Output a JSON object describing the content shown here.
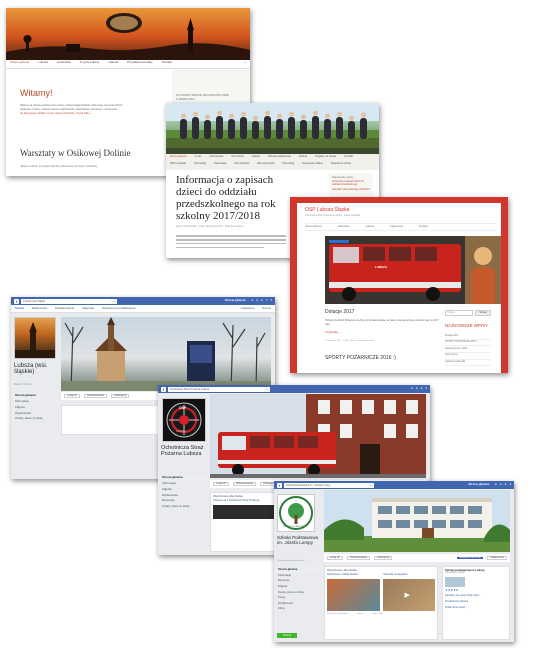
{
  "site1": {
    "nav": [
      "Strona główna",
      "Lubsza",
      "Jednostka",
      "Z życia Lubszy",
      "Galeria",
      "Przydatne kontakty",
      "Kontakt"
    ],
    "heading": "Witamy!",
    "section_title": "Warsztaty w Osikowej Dolinie",
    "sidebar_title": "STOWARZYSZENIE MIŁOŚNIKÓW ZIEMI LUBSZECKIEJ",
    "body_lines": [
      "Witamy na stronie poświęconej Lubszy. Tutaj znajdą Państwo informacje na temat historii",
      "wydarzeń, kultury i tradycji naszej miejscowości. Zapraszamy do lektury i zachęcamy",
      "do aktywnego udziału w życiu naszej wspólnoty. Czytaj dalej →"
    ],
    "caption": "„Bitwa o kulturę” to projekt kulturalny skierowany do dzieci i młodzieży"
  },
  "site2": {
    "nav_row1": [
      "Strona główna",
      "O nas",
      "Nauczyciele",
      "Dla ucznia",
      "Galeria",
      "Szkoła podstawowa",
      "Kultura",
      "Projekty na szkołę",
      "Kontakt"
    ],
    "nav_row2": [
      "RPO Lubelski",
      "Informacje",
      "Rekrutacja",
      "Dla rodziców",
      "Dla nauczycieli",
      "Plan lekcji",
      "Nauczanie zdalne",
      "Regulamin szkoły"
    ],
    "title_lines": [
      "Informacja o zapisach",
      "dzieci do oddziału",
      "przedszkolnego na rok",
      "szkolny 2017/2018"
    ],
    "meta": "Autor: administrator · Data: 12 kwietnia 2017 · Brak komentarzy",
    "sidebar_title": "Najnowsze wpisy",
    "sidebar_lines": [
      "Informacja o zapisach dzieci do oddziału przedszkolnego",
      "Kalendarz roku szkolnego 2016/2017"
    ]
  },
  "site3": {
    "title": "OSP Lubsza Śląska",
    "subtitle": "Ochotnicza Straż Pożarna w Lubszy · strona jednostki",
    "tabs": [
      "Strona główna",
      "Jednostka",
      "Galeria",
      "Ogłoszenia",
      "Kontakt"
    ],
    "post_title": "Dotacje 2017",
    "post_text": "Ochotnicza Straż Pożarna w Lubszy otrzymała dotację na zakup nowego sprzętu ratowniczego w 2017 roku.",
    "read_more": "Czytaj dalej →",
    "post_meta": "25 kwietnia 2017 · OSP Lubsza · Brak komentarzy",
    "section2_title": "SPORTY POŻARNICZE 2016 :)",
    "search_placeholder": "Szukaj...",
    "search_button": "Szukaj",
    "sidebar_title": "NAJNOWSZE WPISY",
    "sidebar_items": [
      "Dotacje 2017",
      "SPORTY POŻARNICZE 2016 :)",
      "Zawody gminne 2016",
      "Nowy sprzęt",
      "Ćwiczenia jednostki"
    ],
    "truck_plate": "LUBSZA"
  },
  "fb1": {
    "search": "Lubsza (wsi Śląski)",
    "nav_right": "Strona główna",
    "cover_tabs": [
      "Strona",
      "Wiadomości",
      "Powiadomienia",
      "Statystyki",
      "Narzędzia do publikowania"
    ],
    "cover_right": [
      "Ustawienia",
      "Pomoc"
    ],
    "page_name": "Lubsza (wsi. śląskie)",
    "page_sub": "Miasto / Gmina",
    "menu": [
      "Strona główna",
      "Informacje",
      "Zdjęcia",
      "Wydarzenia",
      "Osoby, które to lubią"
    ],
    "actions": [
      "Lubię to!",
      "Obserwowanie",
      "Udostępnij"
    ]
  },
  "fb2": {
    "search": "Ochotnicza Straż Pożarna Lubsza",
    "page_name": "Ochotnicza Straż Pożarna Lubsza",
    "menu": [
      "Strona główna",
      "Informacje",
      "Zdjęcia",
      "Wydarzenia",
      "Recenzje",
      "Osoby, które to lubią"
    ],
    "actions": [
      "Lubię to!",
      "Obserwowanie",
      "Udostępnij"
    ],
    "section": "Wyróżnione dla Ciebie",
    "shared": "Obecnie są z Ochotnicza Straż Pożarna...",
    "logo_letters": "OSP",
    "logo_ring": "LUBSZA"
  },
  "fb3": {
    "search": "Szkoła Podstawowa im. Józefa Lompy",
    "nav_right": "Strona główna",
    "page_name": "Szkoła Podstawowa im. Józefa Lompy",
    "page_sub": "@szkolapodstawowa.lubsza",
    "menu": [
      "Strona główna",
      "Informacje",
      "Recenzje",
      "Zdjęcia",
      "Osoby, które to lubią",
      "Posty",
      "Wydarzenia",
      "Filmy"
    ],
    "actions": [
      "Lubię to!",
      "Obserwowanie",
      "Udostępnij"
    ],
    "promote": "Promuj",
    "call_button": "Zadzwoń do firmy",
    "msg_button": "Wiadomość",
    "section": "Wyróżnione dla Ciebie",
    "post1": "Wydarzenia z Szkoła Podsta...",
    "post2": "Dzienniki na wagarach",
    "post_footer": [
      "Dzisiejsze wiadomości",
      "Więcej",
      "Jeden · Nie"
    ],
    "right_title": "Szkoła podstawowa w Lubszy",
    "right_sub": "Gimnazjum, Piaski",
    "rating": "★★★★★",
    "right_items": [
      "Narodziny dni, kiedy dzwoni okno...",
      "Przedszkolna ulubiona",
      "Ostatni dzień szkoły"
    ],
    "logo_ring": "SZKOŁA PODSTAWOWA"
  },
  "colors": {
    "facebook_blue": "#4267b2",
    "osp_red": "#d3362c",
    "accent_orange": "#d9602a"
  }
}
